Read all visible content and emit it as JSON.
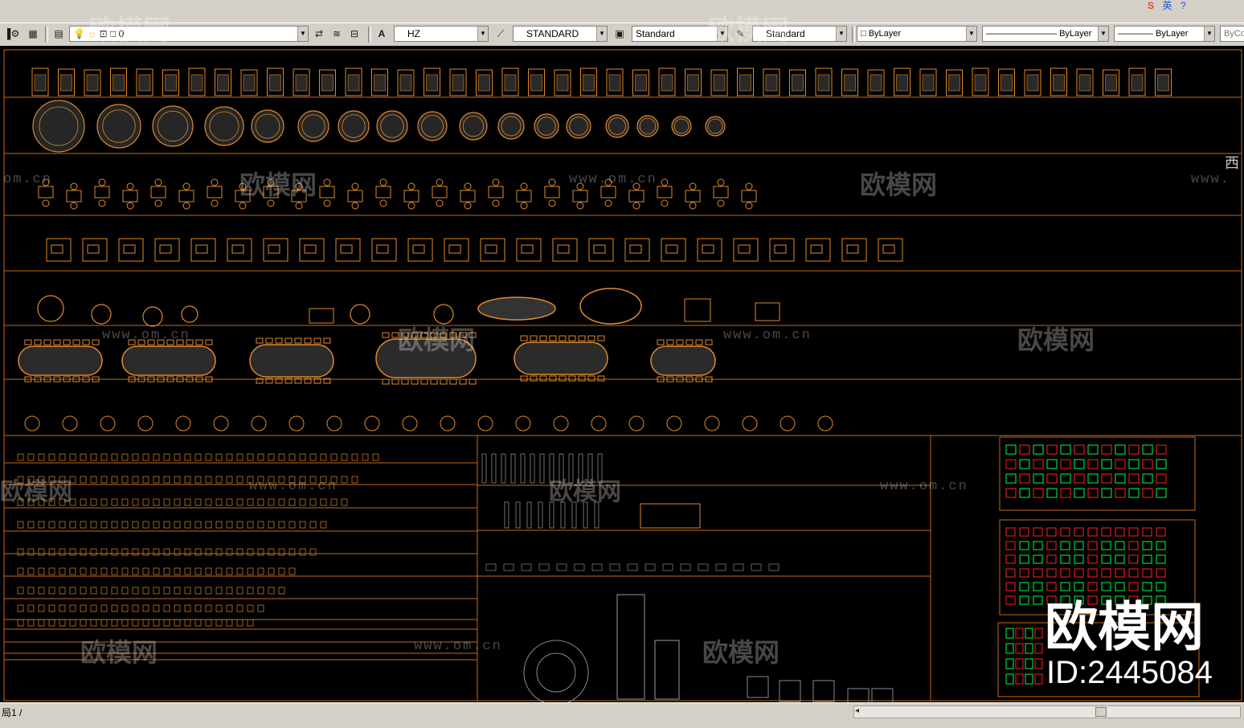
{
  "tray": {
    "logo": "S",
    "label": "英",
    "icons": [
      "ime-icon",
      "help-icon"
    ]
  },
  "toolbar": {
    "layer_value": "0",
    "text_style_value": "HZ",
    "dim_style_value": "STANDARD",
    "table_style_value": "Standard",
    "mleader_style_value": "Standard",
    "color_value": "ByLayer",
    "linetype_value": "ByLayer",
    "lineweight_value": "ByLayer",
    "plotstyle_value": "ByCo"
  },
  "canvas": {
    "side_label": "西",
    "watermark_brand": "欧模网",
    "watermark_url": "www.om.cn",
    "watermark_url_prefix": "om.cn",
    "watermark_url_suffix": "www.",
    "line_color": "#c56a1a",
    "symbol_color": "#e08a2a",
    "accent_green": "#00ff40",
    "accent_red": "#ff2020"
  },
  "overlay": {
    "brand": "欧模网",
    "id_text": "ID:2445084"
  },
  "status": {
    "layout_tab": "局1"
  }
}
